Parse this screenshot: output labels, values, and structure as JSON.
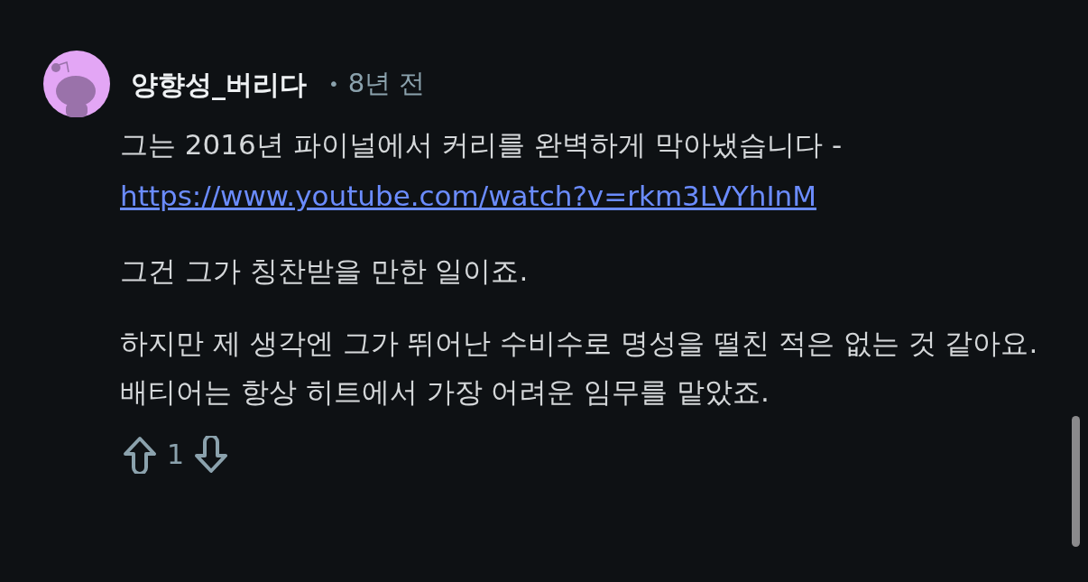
{
  "comment": {
    "author": "양향성_버리다",
    "separator": "•",
    "age": "8년 전",
    "paragraphs": [
      {
        "text": "그는 2016년 파이널에서 커리를 완벽하게 막아냈습니다 -",
        "link": "https://www.youtube.com/watch?v=rkm3LVYhInM"
      },
      {
        "text": "그건 그가 칭찬받을 만한 일이죠."
      },
      {
        "text": "하지만 제 생각엔 그가 뛰어난 수비수로 명성을 떨친 적은 없는 것 같아요. 배티어는 항상 히트에서 가장 어려운 임무를 맡았죠."
      }
    ],
    "score": "1"
  }
}
